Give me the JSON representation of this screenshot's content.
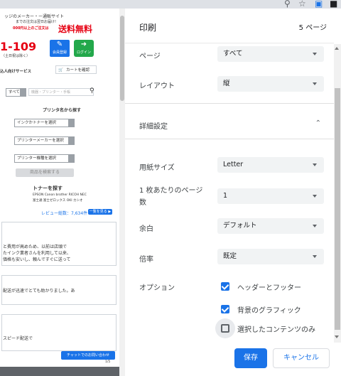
{
  "browser": {
    "icons": [
      "search-icon",
      "star-icon",
      "extension-icon",
      "profile-icon"
    ]
  },
  "preview": {
    "header_line": "ッジのメーカー・ー通販サイト",
    "promo_small": "までの注文は翌日お届け!",
    "promo_small2": "000円以上のご注文は",
    "promo_big": "送料無料",
    "phone": "1-109",
    "phone_note": "（土日祝は除く）",
    "member_label": "会員登録",
    "login_label": "ログイン",
    "service_label": "込人向けサービス",
    "cart_label": "カートを確認",
    "search_scope": "すべて",
    "search_placeholder": "機器・プリンター・手帳",
    "printer_search_title": "プリンタ名から探す",
    "select_ink": "インクかトナーを選択",
    "select_maker": "プリンターメーカーを選択",
    "select_model": "プリンター機種を選択",
    "product_search_btn": "商品を検索する",
    "toner_title": "トナーを探す",
    "toner_brands1": "EPSON Canon brother RICOH NEC",
    "toner_brands2": "富士通 富士ゼロックス OKI カシオ",
    "review_count": "レビュー総数：7,634件",
    "review_all": "一覧を見る ▶",
    "review1_l1": "と費用が高めため、以前は店頭で",
    "review1_l2": "たインク業者さんを利用して以来、",
    "review1_l3": "価格も安いし、頼んですぐに送って",
    "review2_l1": "配送が迅速でとても助かりました。あ",
    "review3_l1": "スピード配送で",
    "chat_label": "チャットでのお問い合わせ",
    "page_counter": "1/5"
  },
  "dialog": {
    "title": "印刷",
    "page_count": "5 ページ",
    "pages_label": "ページ",
    "pages_value": "すべて",
    "layout_label": "レイアウト",
    "layout_value": "縦",
    "more_settings_label": "詳細設定",
    "paper_size_label": "用紙サイズ",
    "paper_size_value": "Letter",
    "pages_per_sheet_label_1": "1 枚あたりのページ",
    "pages_per_sheet_label_2": "数",
    "pages_per_sheet_value": "1",
    "margins_label": "余白",
    "margins_value": "デフォルト",
    "scale_label": "倍率",
    "scale_value": "既定",
    "options_label": "オプション",
    "options": [
      {
        "label": "ヘッダーとフッター",
        "checked": true
      },
      {
        "label": "背景のグラフィック",
        "checked": true
      },
      {
        "label": "選択したコンテンツのみ",
        "checked": false
      }
    ],
    "save_button": "保存",
    "cancel_button": "キャンセル"
  },
  "colors": {
    "accent": "#1a73e8",
    "select_bg": "#f1f3f4",
    "promo_red": "#e60012",
    "member_green": "#23a84b"
  }
}
